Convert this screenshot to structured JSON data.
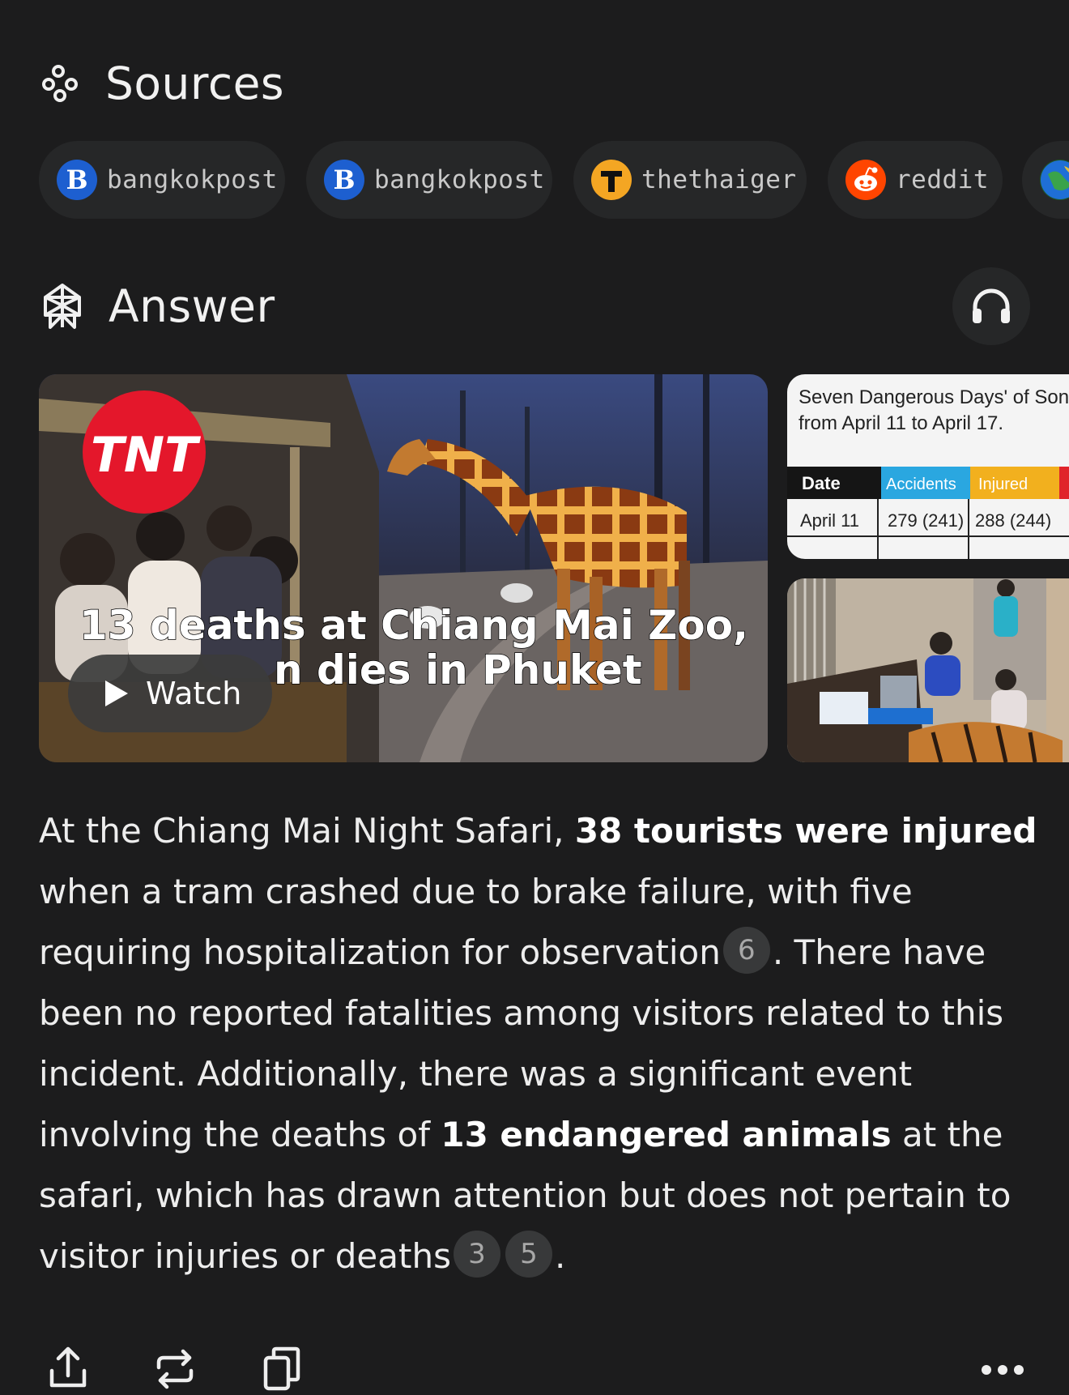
{
  "sources": {
    "title": "Sources",
    "icon": "sources-icon",
    "chips": [
      {
        "label": "bangkokpost",
        "icon": "bangkokpost-logo-icon"
      },
      {
        "label": "bangkokpost",
        "icon": "bangkokpost-logo-icon"
      },
      {
        "label": "thethaiger",
        "icon": "thethaiger-logo-icon"
      },
      {
        "label": "reddit",
        "icon": "reddit-logo-icon"
      },
      {
        "label": "",
        "icon": "globe-icon"
      }
    ]
  },
  "answer": {
    "title": "Answer",
    "icon": "perplexity-icon",
    "listen_icon": "headphones-icon",
    "media": {
      "main": {
        "badge": "TNT",
        "headline_line1": "13 deaths at Chiang Mai Zoo,",
        "headline_line2": "n dies in Phuket",
        "watch_label": "Watch"
      },
      "side_top": {
        "caption_line1": "Seven Dangerous Days' of Songkr",
        "caption_line2": "from April 11 to April 17.",
        "table_headers": [
          "Date",
          "Accidents",
          "Injured"
        ],
        "table_row": [
          "April 11",
          "279 (241)",
          "288 (244)"
        ]
      }
    },
    "paragraph": {
      "s1": "At the Chiang Mai Night Safari, ",
      "b1": "38 tourists were injured",
      "s2": " when a tram crashed due to brake failure, with five requiring hospitalization for observation",
      "cite1": "6",
      "s3": ". There have been no reported fatalities among visitors related to this incident. Additionally, there was a significant event involving the deaths of ",
      "b2": "13 endangered animals",
      "s4": " at the safari, which has drawn attention but does not pertain to visitor injuries or deaths",
      "cite2": "3",
      "cite3": "5",
      "s5": "."
    }
  },
  "toolbar": {
    "share_icon": "share-icon",
    "rewrite_icon": "rewrite-icon",
    "copy_icon": "copy-icon",
    "more_icon": "more-icon"
  },
  "colors": {
    "background": "#1c1c1d",
    "chip_bg": "#262728",
    "citation_bg": "#38393a",
    "tnt_red": "#e4172b",
    "reddit_orange": "#ff4500",
    "bangkokpost_blue": "#1d5fd0"
  }
}
